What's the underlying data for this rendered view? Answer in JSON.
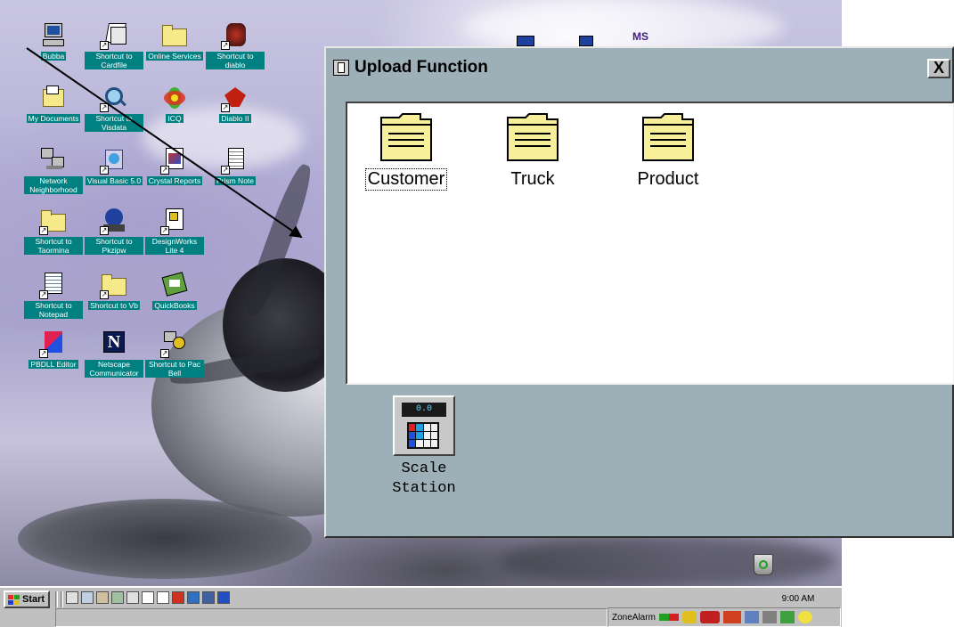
{
  "desktop": {
    "icons": [
      {
        "label": "Bubba",
        "icon": "computer-icon"
      },
      {
        "label": "Shortcut to Cardfile",
        "icon": "cardfile-icon"
      },
      {
        "label": "Online Services",
        "icon": "folder-icon"
      },
      {
        "label": "Shortcut to diablo",
        "icon": "diablo-icon"
      },
      {
        "label": "My Documents",
        "icon": "documents-folder-icon"
      },
      {
        "label": "Shortcut to Visdata",
        "icon": "visdata-icon"
      },
      {
        "label": "ICQ",
        "icon": "icq-flower-icon"
      },
      {
        "label": "Diablo II",
        "icon": "diablo2-icon"
      },
      {
        "label": "Network Neighborhood",
        "icon": "network-icon"
      },
      {
        "label": "Visual Basic 5.0",
        "icon": "visual-basic-icon"
      },
      {
        "label": "Crystal Reports",
        "icon": "crystal-reports-icon"
      },
      {
        "label": "Prism Note",
        "icon": "notepad-page-icon"
      },
      {
        "label": "Shortcut to Taormina",
        "icon": "folder-icon"
      },
      {
        "label": "Shortcut to Pkzipw",
        "icon": "pkzip-icon"
      },
      {
        "label": "DesignWorks Lite 4",
        "icon": "designworks-icon"
      },
      {
        "label": "Shortcut to Notepad",
        "icon": "notepad-icon"
      },
      {
        "label": "Shortcut to Vb",
        "icon": "folder-icon"
      },
      {
        "label": "QuickBooks",
        "icon": "quickbooks-icon"
      },
      {
        "label": "PBDLL Editor",
        "icon": "pb-icon"
      },
      {
        "label": "Netscape Communicator",
        "icon": "netscape-icon"
      },
      {
        "label": "Shortcut to Pac Bell",
        "icon": "pacbell-icon"
      }
    ],
    "top_icons_partial": [
      "MS"
    ]
  },
  "window": {
    "title": "Upload Function",
    "close_label": "X",
    "folders": [
      {
        "label": "Customer",
        "selected": true
      },
      {
        "label": "Truck",
        "selected": false
      },
      {
        "label": "Product",
        "selected": false
      }
    ],
    "scale": {
      "line1": "Scale",
      "line2": "Station",
      "display": "0.0"
    }
  },
  "taskbar": {
    "start_label": "Start",
    "tray_label": "ZoneAlarm",
    "clock": "9:00 AM"
  },
  "colors": {
    "window_bg": "#9db0b8",
    "desktop_label_bg": "#008080",
    "folder_yellow": "#f7ef9a",
    "taskbar": "#c0c0c0"
  }
}
